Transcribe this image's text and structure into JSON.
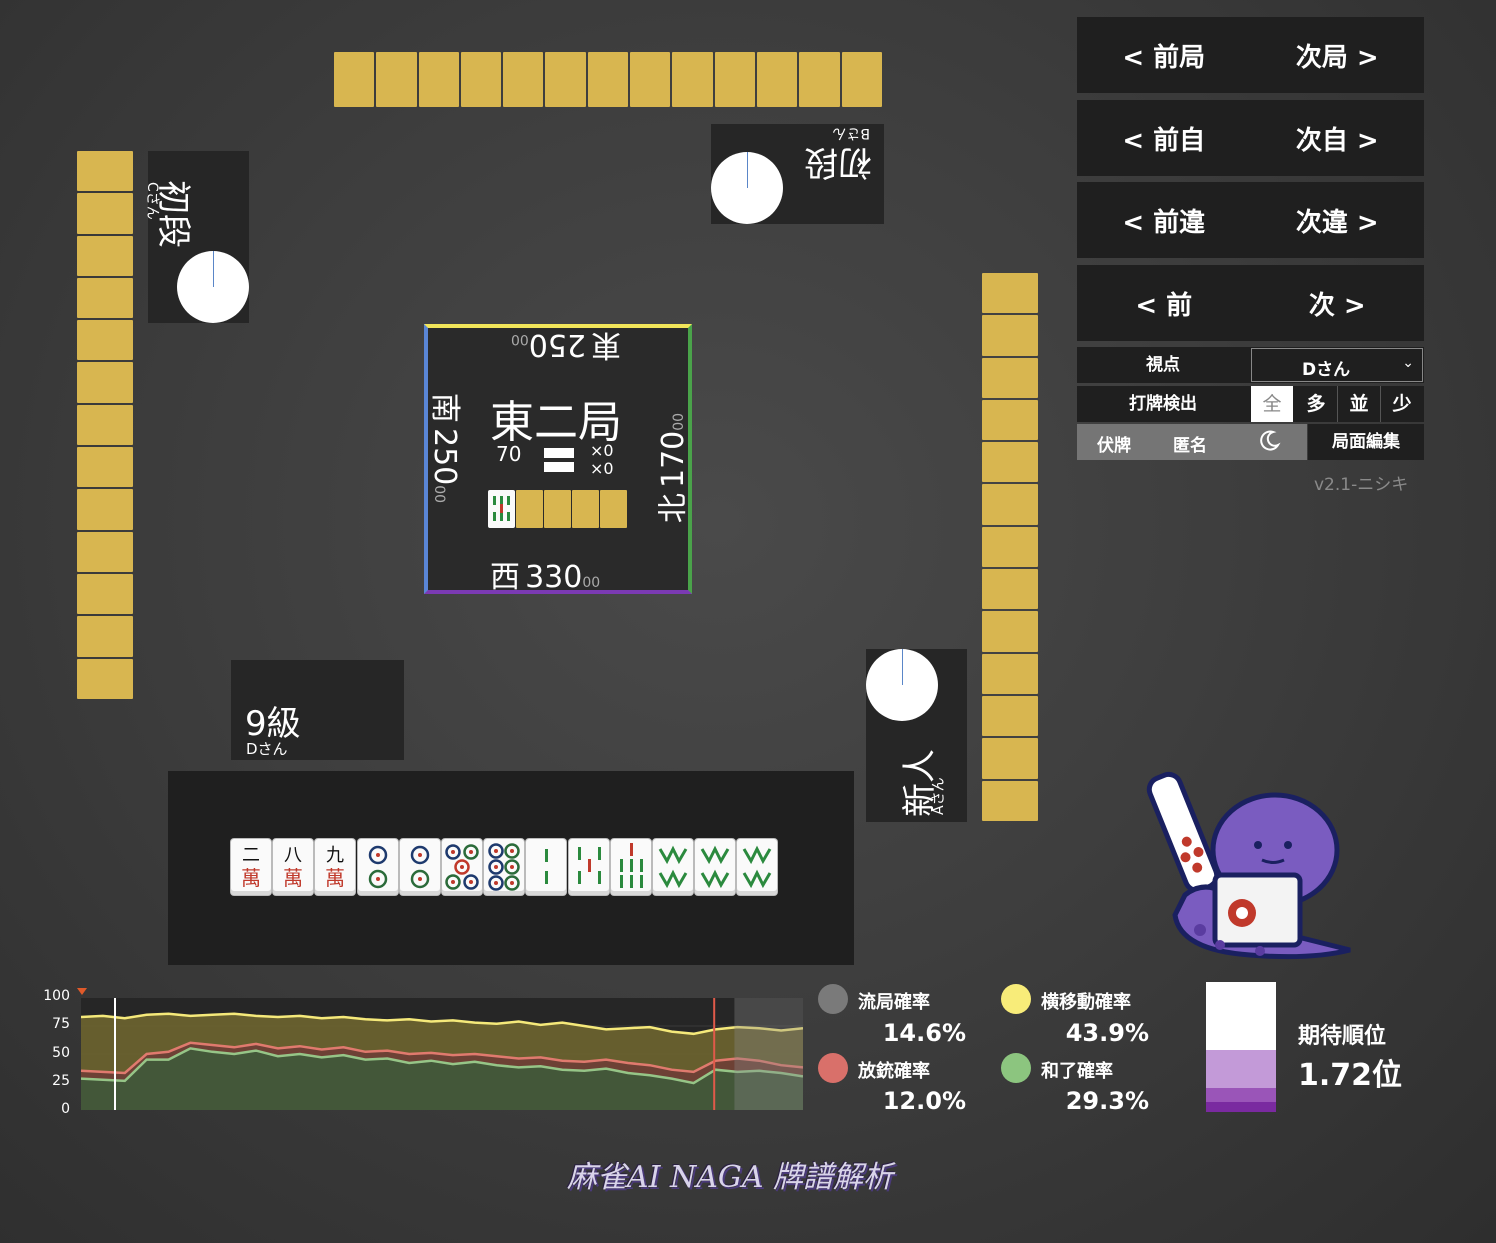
{
  "players": {
    "top": {
      "rank": "初段",
      "name": "Bさん"
    },
    "left": {
      "rank": "初段",
      "name": "Cさん"
    },
    "right": {
      "rank": "新人",
      "name": "Aさん"
    },
    "self": {
      "rank": "9級",
      "name": "Dさん"
    }
  },
  "center": {
    "round": "東二局",
    "riichi_sticks": "70",
    "honba": "×0",
    "kyotaku": "×0",
    "east": {
      "wind": "東",
      "score": "250",
      "small": "00"
    },
    "south": {
      "wind": "南",
      "score": "250",
      "small": "00"
    },
    "west": {
      "wind": "西",
      "score": "330",
      "small": "00"
    },
    "north": {
      "wind": "北",
      "score": "170",
      "small": "00"
    }
  },
  "nav": {
    "prev_round": "< 前局",
    "next_round": "次局 >",
    "prev_self": "< 前自",
    "next_self": "次自 >",
    "prev_diff": "< 前違",
    "next_diff": "次違 >",
    "prev": "< 前",
    "next": "次 >"
  },
  "controls": {
    "viewpoint_label": "視点",
    "viewpoint_value": "Dさん",
    "detect_label": "打牌検出",
    "detect_options": [
      "全",
      "多",
      "並",
      "少"
    ],
    "hidden_tiles": "伏牌",
    "anonymous": "匿名",
    "moon_icon": "moon-icon",
    "edit": "局面編集",
    "version": "v2.1-ニシキ"
  },
  "hand": [
    "二萬",
    "八萬",
    "九萬",
    "2筒",
    "2筒",
    "5筒",
    "6筒",
    "2索",
    "5索",
    "7索",
    "8索",
    "8索",
    "8索"
  ],
  "chart_data": {
    "type": "area",
    "ylim": [
      0,
      100
    ],
    "yticks": [
      "100",
      "75",
      "50",
      "25",
      "0"
    ],
    "series": [
      {
        "name": "横移動確率",
        "color": "#f5e97a",
        "values": [
          83,
          84,
          82,
          85,
          86,
          84,
          85,
          86,
          84,
          83,
          84,
          82,
          83,
          81,
          80,
          81,
          79,
          80,
          78,
          77,
          79,
          76,
          78,
          75,
          72,
          73,
          74,
          70,
          68,
          72,
          74,
          73,
          71,
          73
        ]
      },
      {
        "name": "放銃確率",
        "color": "#e07a6e",
        "values": [
          35,
          34,
          33,
          50,
          52,
          60,
          58,
          56,
          59,
          55,
          57,
          54,
          56,
          52,
          53,
          50,
          51,
          49,
          50,
          48,
          46,
          47,
          44,
          43,
          45,
          42,
          40,
          36,
          34,
          44,
          46,
          44,
          40,
          38
        ]
      },
      {
        "name": "和了確率",
        "color": "#96c587",
        "values": [
          28,
          27,
          26,
          45,
          45,
          55,
          52,
          50,
          53,
          48,
          50,
          47,
          49,
          45,
          46,
          42,
          44,
          41,
          43,
          40,
          38,
          39,
          36,
          35,
          37,
          33,
          31,
          28,
          24,
          36,
          34,
          35,
          33,
          30
        ]
      }
    ]
  },
  "stats": {
    "ryukyoku": {
      "label": "流局確率",
      "value": "14.6%",
      "color": "#7a7a7a"
    },
    "yoko": {
      "label": "横移動確率",
      "value": "43.9%",
      "color": "#f8ec79"
    },
    "houju": {
      "label": "放銃確率",
      "value": "12.0%",
      "color": "#d9706a"
    },
    "hora": {
      "label": "和了確率",
      "value": "29.3%",
      "color": "#8cc57f"
    },
    "expected_rank_label": "期待順位",
    "expected_rank_value": "1.72位"
  },
  "footer_logo": "麻雀AI NAGA 牌譜解析"
}
